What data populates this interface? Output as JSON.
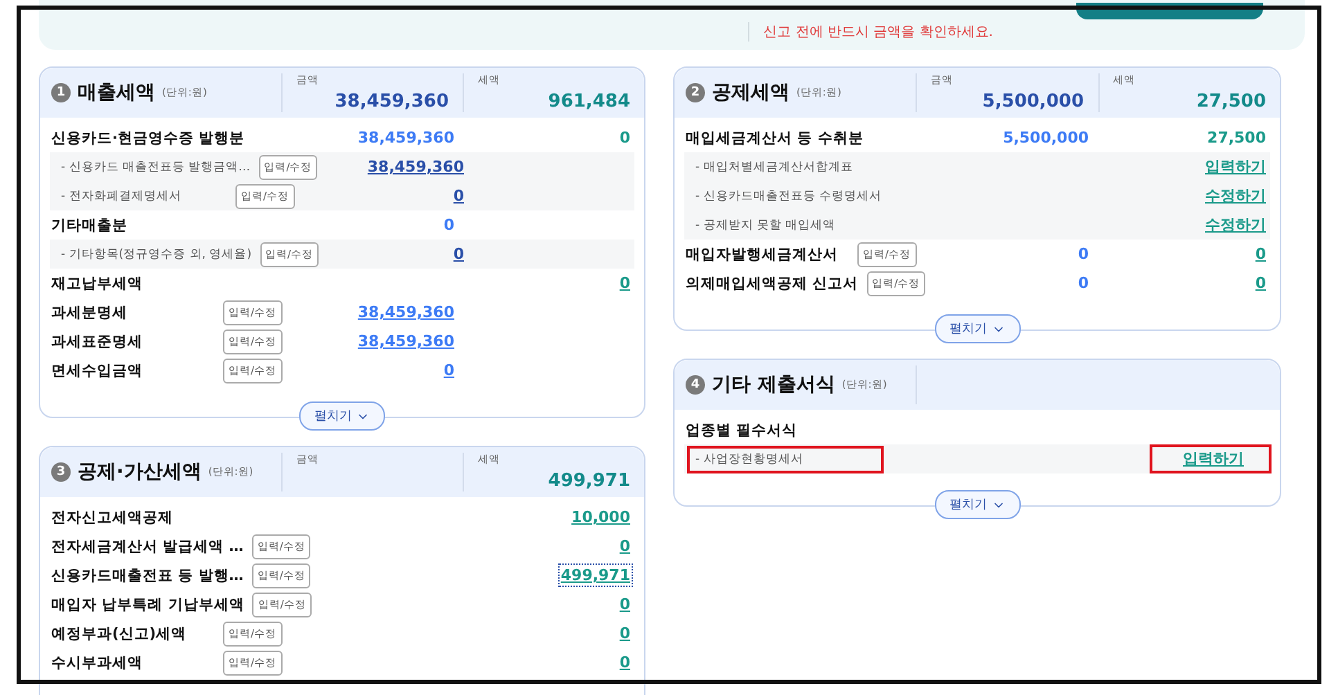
{
  "banner": {
    "notice": "신고 전에 반드시 금액을 확인하세요."
  },
  "columns": [
    {
      "panels": [
        {
          "number": "1",
          "title": "매출세액",
          "unit": "(단위:원)",
          "amount_label": "금액",
          "amount": "38,459,360",
          "tax_label": "세액",
          "tax": "961,484",
          "expand": "펼치기",
          "rows": [
            {
              "kind": "main",
              "label": "신용카드·현금영수증 발행분",
              "amount": "38,459,360",
              "tax": "0"
            },
            {
              "kind": "sub",
              "label": "- 신용카드 매출전표등 발행금액…",
              "button": "입력/수정",
              "amount": "38,459,360",
              "amount_link": true
            },
            {
              "kind": "sub",
              "label": "- 전자화폐결제명세서",
              "button": "입력/수정",
              "amount": "0",
              "amount_link": true
            },
            {
              "kind": "main",
              "label": "기타매출분",
              "amount": "0"
            },
            {
              "kind": "sub",
              "label": "- 기타항목(정규영수증 외, 영세율)",
              "button": "입력/수정",
              "amount": "0",
              "amount_link": true
            },
            {
              "kind": "main",
              "label": "재고납부세액",
              "tax": "0",
              "tax_link": true
            },
            {
              "kind": "main",
              "label": "과세분명세",
              "button": "입력/수정",
              "amount": "38,459,360",
              "amount_link": true
            },
            {
              "kind": "main",
              "label": "과세표준명세",
              "button": "입력/수정",
              "amount": "38,459,360",
              "amount_link": true
            },
            {
              "kind": "main",
              "label": "면세수입금액",
              "button": "입력/수정",
              "amount": "0",
              "amount_link": true
            }
          ]
        },
        {
          "number": "3",
          "title": "공제·가산세액",
          "unit": "(단위:원)",
          "amount_label": "금액",
          "tax_label": "세액",
          "tax": "499,971",
          "rows": [
            {
              "kind": "main",
              "label": "전자신고세액공제",
              "tax": "10,000",
              "tax_link": true
            },
            {
              "kind": "main",
              "label": "전자세금계산서 발급세액 …",
              "button": "입력/수정",
              "tax": "0",
              "tax_link": true
            },
            {
              "kind": "main",
              "label": "신용카드매출전표 등 발행…",
              "button": "입력/수정",
              "tax": "499,971",
              "tax_link": true,
              "focused": true
            },
            {
              "kind": "main",
              "label": "매입자 납부특례 기납부세액",
              "button": "입력/수정",
              "tax": "0",
              "tax_link": true
            },
            {
              "kind": "main",
              "label": "예정부과(신고)세액",
              "button": "입력/수정",
              "tax": "0",
              "tax_link": true
            },
            {
              "kind": "main",
              "label": "수시부과세액",
              "button": "입력/수정",
              "tax": "0",
              "tax_link": true
            }
          ]
        }
      ]
    },
    {
      "panels": [
        {
          "number": "2",
          "title": "공제세액",
          "unit": "(단위:원)",
          "amount_label": "금액",
          "amount": "5,500,000",
          "tax_label": "세액",
          "tax": "27,500",
          "expand": "펼치기",
          "rows": [
            {
              "kind": "main",
              "label": "매입세금계산서 등 수취분",
              "amount": "5,500,000",
              "tax": "27,500"
            },
            {
              "kind": "sub",
              "label": "- 매입처별세금계산서합계표",
              "tax": "입력하기",
              "tax_link": true
            },
            {
              "kind": "sub",
              "label": "- 신용카드매출전표등 수령명세서",
              "tax": "수정하기",
              "tax_link": true
            },
            {
              "kind": "sub",
              "label": "- 공제받지 못할 매입세액",
              "tax": "수정하기",
              "tax_link": true
            },
            {
              "kind": "main",
              "label": "매입자발행세금계산서",
              "button": "입력/수정",
              "amount": "0",
              "tax": "0",
              "tax_link": true
            },
            {
              "kind": "main",
              "label": "의제매입세액공제 신고서",
              "button": "입력/수정",
              "amount": "0",
              "tax": "0",
              "tax_link": true
            }
          ]
        },
        {
          "number": "4",
          "title": "기타 제출서식",
          "unit": "(단위:원)",
          "expand": "펼치기",
          "rows": [
            {
              "kind": "main",
              "label": "업종별 필수서식"
            },
            {
              "kind": "sub",
              "label": "- 사업장현황명세서",
              "tax": "입력하기",
              "tax_link": true,
              "highlighted": true
            }
          ]
        }
      ]
    }
  ]
}
